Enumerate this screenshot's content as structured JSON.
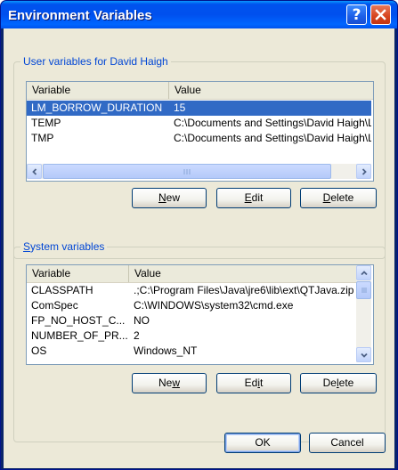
{
  "window": {
    "title": "Environment Variables",
    "help_label": "?"
  },
  "user_group": {
    "legend": "User variables for David Haigh",
    "columns": [
      "Variable",
      "Value"
    ],
    "rows": [
      {
        "variable": "LM_BORROW_DURATION",
        "value": "15",
        "selected": true
      },
      {
        "variable": "TEMP",
        "value": "C:\\Documents and Settings\\David Haigh\\Local Settings\\Temp",
        "selected": false
      },
      {
        "variable": "TMP",
        "value": "C:\\Documents and Settings\\David Haigh\\Local Settings\\Temp",
        "selected": false
      }
    ],
    "buttons": {
      "new_pre": "",
      "new_key": "N",
      "new_post": "ew",
      "edit_pre": "",
      "edit_key": "E",
      "edit_post": "dit",
      "delete_pre": "",
      "delete_key": "D",
      "delete_post": "elete"
    }
  },
  "system_group": {
    "legend_key": "S",
    "legend_rest": "ystem variables",
    "columns": [
      "Variable",
      "Value"
    ],
    "rows": [
      {
        "variable": "CLASSPATH",
        "value": ".;C:\\Program Files\\Java\\jre6\\lib\\ext\\QTJava.zip",
        "selected": false
      },
      {
        "variable": "ComSpec",
        "value": "C:\\WINDOWS\\system32\\cmd.exe",
        "selected": false
      },
      {
        "variable": "FP_NO_HOST_C...",
        "value": "NO",
        "selected": false
      },
      {
        "variable": "NUMBER_OF_PR...",
        "value": "2",
        "selected": false
      },
      {
        "variable": "OS",
        "value": "Windows_NT",
        "selected": false
      }
    ],
    "buttons": {
      "new_pre": "Ne",
      "new_key": "w",
      "new_post": "",
      "edit_pre": "Ed",
      "edit_key": "i",
      "edit_post": "t",
      "delete_pre": "De",
      "delete_key": "l",
      "delete_post": "ete"
    }
  },
  "footer": {
    "ok_label": "OK",
    "cancel_label": "Cancel"
  },
  "colors": {
    "title_bar": "#0054e3",
    "selection": "#316ac5",
    "dialog_bg": "#ece9d8",
    "group_legend": "#0046d5"
  }
}
